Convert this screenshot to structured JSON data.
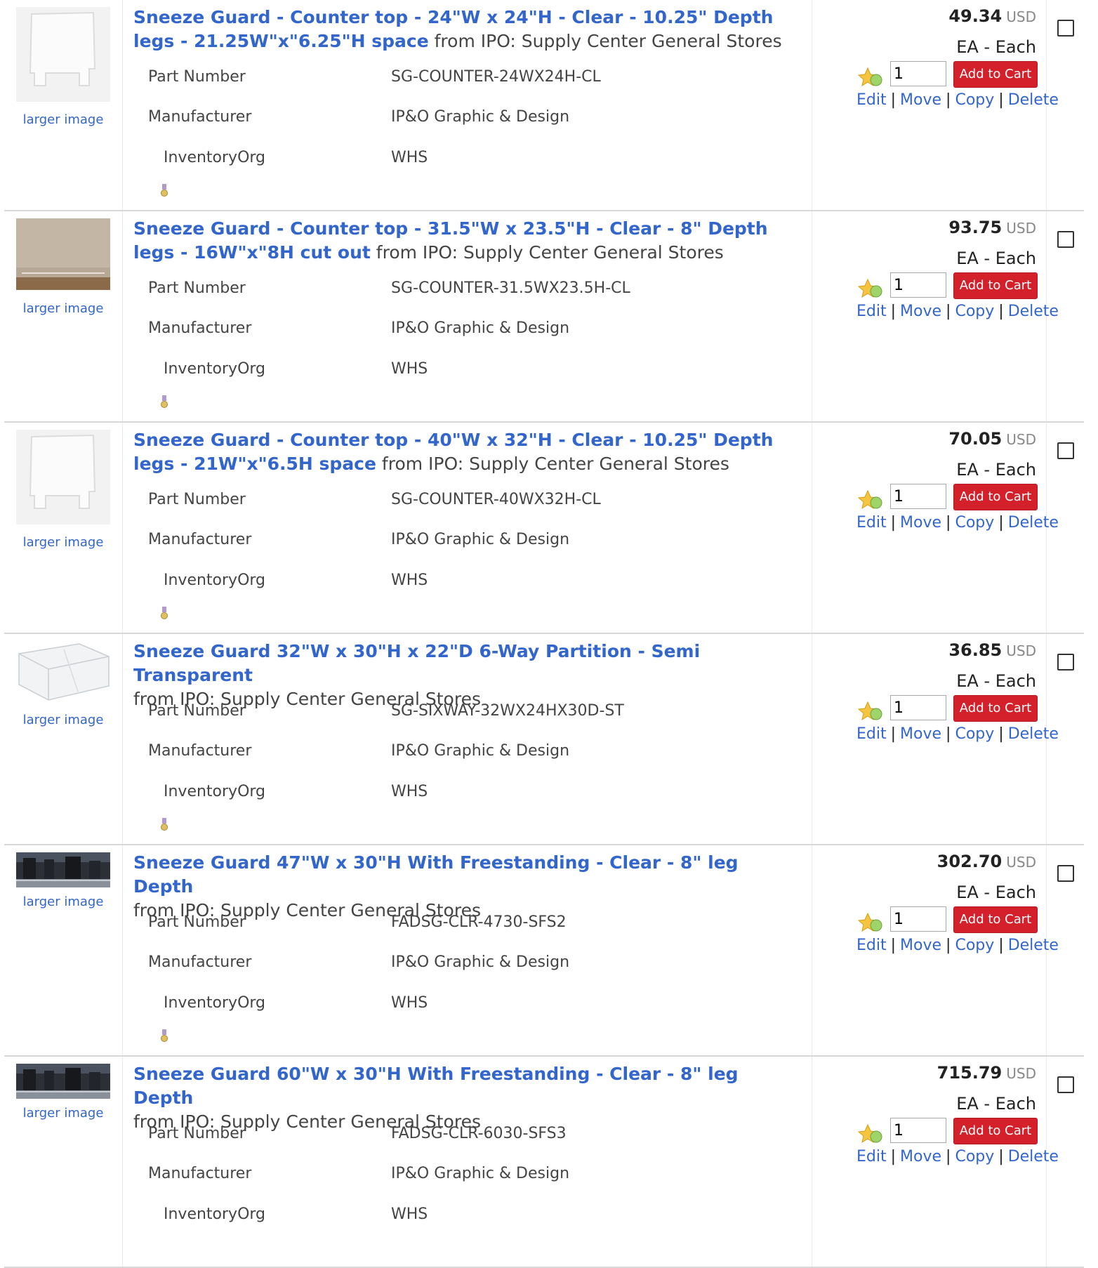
{
  "labels": {
    "larger_image": "larger image",
    "part_number": "Part Number",
    "manufacturer": "Manufacturer",
    "inventory_org": "InventoryOrg",
    "add_to_cart": "Add to Cart",
    "edit": "Edit",
    "move": "Move",
    "copy": "Copy",
    "delete": "Delete",
    "separator": "|"
  },
  "colors": {
    "link": "#3366cc",
    "add_to_cart_bg": "#d4202a",
    "divider": "#d8d8d8"
  },
  "items": [
    {
      "name": "Sneeze Guard - Counter top - 24\"W x 24\"H - Clear - 10.25\" Depth legs - 21.25W\"x\"6.25\"H space",
      "from": " from IPO: Supply Center General Stores",
      "part_number": "SG-COUNTER-24WX24H-CL",
      "manufacturer": "IP&O Graphic & Design",
      "inventory_org": "WHS",
      "price": "49.34",
      "currency": "USD",
      "uom": "EA - Each",
      "quantity": "1",
      "image": "white-panel"
    },
    {
      "name": "Sneeze Guard - Counter top - 31.5\"W x 23.5\"H - Clear - 8\" Depth legs - 16W\"x\"8H cut out",
      "from": " from IPO: Supply Center General Stores",
      "part_number": "SG-COUNTER-31.5WX23.5H-CL",
      "manufacturer": "IP&O Graphic & Design",
      "inventory_org": "WHS",
      "price": "93.75",
      "currency": "USD",
      "uom": "EA - Each",
      "quantity": "1",
      "image": "clear-panel-photo"
    },
    {
      "name": "Sneeze Guard - Counter top - 40\"W x 32\"H - Clear - 10.25\" Depth legs - 21W\"x\"6.5H space",
      "from": " from IPO: Supply Center General Stores",
      "part_number": "SG-COUNTER-40WX32H-CL",
      "manufacturer": "IP&O Graphic & Design",
      "inventory_org": "WHS",
      "price": "70.05",
      "currency": "USD",
      "uom": "EA - Each",
      "quantity": "1",
      "image": "white-panel"
    },
    {
      "name": "Sneeze Guard 32\"W x 30\"H x 22\"D 6-Way Partition - Semi Transparent",
      "from": "from IPO: Supply Center General Stores",
      "part_number": "SG-SIXWAY-32WX24HX30D-ST",
      "manufacturer": "IP&O Graphic & Design",
      "inventory_org": "WHS",
      "price": "36.85",
      "currency": "USD",
      "uom": "EA - Each",
      "quantity": "1",
      "image": "partition"
    },
    {
      "name": "Sneeze Guard 47\"W x 30\"H With Freestanding - Clear - 8\" leg Depth",
      "from": "from IPO: Supply Center General Stores",
      "part_number": "FADSG-CLR-4730-SFS2",
      "manufacturer": "IP&O Graphic & Design",
      "inventory_org": "WHS",
      "price": "302.70",
      "currency": "USD",
      "uom": "EA - Each",
      "quantity": "1",
      "image": "dark-strip"
    },
    {
      "name": "Sneeze Guard 60\"W x 30\"H With Freestanding - Clear - 8\" leg Depth",
      "from": "from IPO: Supply Center General Stores",
      "part_number": "FADSG-CLR-6030-SFS3",
      "manufacturer": "IP&O Graphic & Design",
      "inventory_org": "WHS",
      "price": "715.79",
      "currency": "USD",
      "uom": "EA - Each",
      "quantity": "1",
      "image": "dark-strip"
    }
  ]
}
